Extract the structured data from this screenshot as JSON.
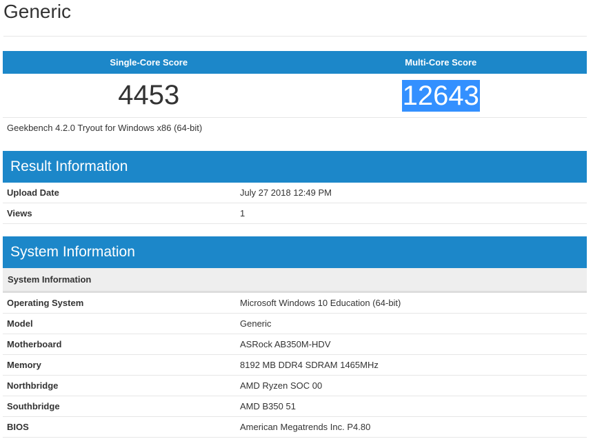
{
  "page": {
    "title": "Generic"
  },
  "scores": {
    "single_core_label": "Single-Core Score",
    "multi_core_label": "Multi-Core Score",
    "single_core_value": "4453",
    "multi_core_value": "12643",
    "caption": "Geekbench 4.2.0 Tryout for Windows x86 (64-bit)"
  },
  "result_information": {
    "heading": "Result Information",
    "rows": [
      {
        "label": "Upload Date",
        "value": "July 27 2018 12:49 PM"
      },
      {
        "label": "Views",
        "value": "1"
      }
    ]
  },
  "system_information": {
    "heading": "System Information",
    "subheading": "System Information",
    "rows": [
      {
        "label": "Operating System",
        "value": "Microsoft Windows 10 Education (64-bit)"
      },
      {
        "label": "Model",
        "value": "Generic"
      },
      {
        "label": "Motherboard",
        "value": "ASRock AB350M-HDV"
      },
      {
        "label": "Memory",
        "value": "8192 MB DDR4 SDRAM 1465MHz"
      },
      {
        "label": "Northbridge",
        "value": "AMD Ryzen SOC 00"
      },
      {
        "label": "Southbridge",
        "value": "AMD B350 51"
      },
      {
        "label": "BIOS",
        "value": "American Megatrends Inc. P4.80"
      }
    ]
  },
  "colors": {
    "header_blue": "#1c87c9",
    "selection_blue": "#3390ff",
    "text": "#333333",
    "divider": "#e6e6e6",
    "subheader_bg": "#eeeeee"
  }
}
